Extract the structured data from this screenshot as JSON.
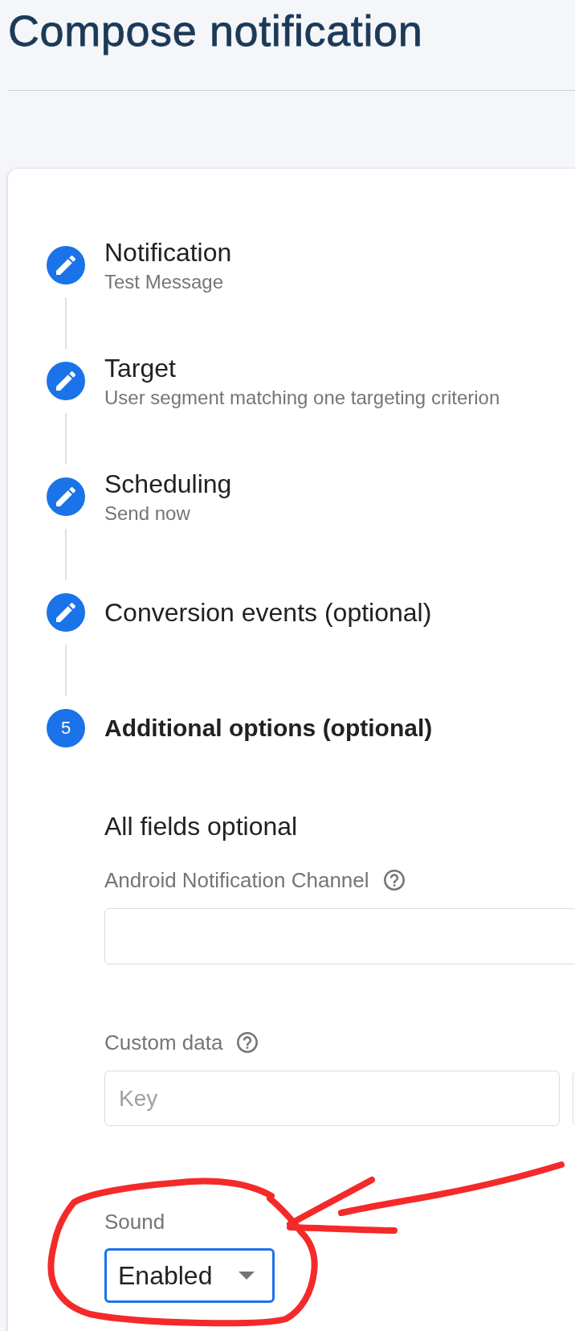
{
  "page": {
    "title": "Compose notification"
  },
  "steps": [
    {
      "title": "Notification",
      "subtitle": "Test Message",
      "kind": "completed",
      "selected": false
    },
    {
      "title": "Target",
      "subtitle": "User segment matching one targeting criterion",
      "kind": "completed",
      "selected": false
    },
    {
      "title": "Scheduling",
      "subtitle": "Send now",
      "kind": "completed",
      "selected": false
    },
    {
      "title": "Conversion events (optional)",
      "kind": "completed",
      "selected": false
    },
    {
      "title": "Additional options (optional)",
      "number": "5",
      "kind": "current",
      "selected": true
    }
  ],
  "section": {
    "heading": "All fields optional"
  },
  "fields": [
    {
      "kind": "text",
      "label": "Android Notification Channel",
      "help": true,
      "annotated": false
    },
    {
      "kind": "key_value",
      "label": "Custom data",
      "help": true,
      "key_placeholder": "Key",
      "annotated": false
    },
    {
      "kind": "select",
      "label": "Sound",
      "help": false,
      "value": "Enabled",
      "focused": true,
      "annotated": true
    }
  ]
}
